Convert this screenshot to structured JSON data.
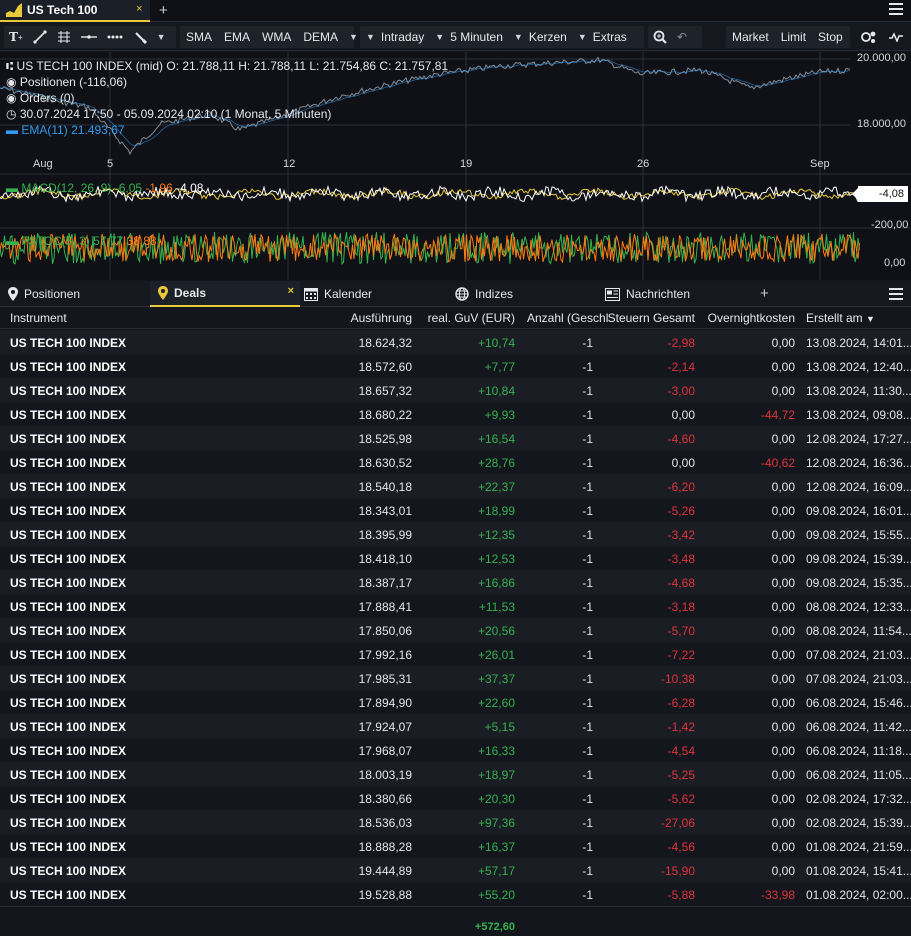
{
  "topbar": {
    "tab_title": "US Tech 100",
    "close_glyph": "×",
    "plus_glyph": "+"
  },
  "toolbar": {
    "indicators": [
      "SMA",
      "EMA",
      "WMA",
      "DEMA"
    ],
    "period": "Intraday",
    "interval": "5 Minuten",
    "chart_type": "Kerzen",
    "extras": "Extras",
    "orders": [
      "Market",
      "Limit",
      "Stop"
    ],
    "icons": [
      "text-tool-icon",
      "line-tool-icon",
      "fib-tool-icon",
      "hline-tool-icon",
      "dotted-line-icon",
      "brush-tool-icon",
      "zoom-icon",
      "undo-icon",
      "compare-icon",
      "signal-icon"
    ]
  },
  "chart": {
    "ohlc_line": "US TECH 100 INDEX (mid)  O: 21.788,11  H: 21.788,11  L: 21.754,86  C: 21.757,81",
    "positions": "Positionen (-116,06)",
    "orders": "Orders (0)",
    "range": "30.07.2024 17:50 - 05.09.2024 02:10  (1 Monat, 5 Minuten)",
    "ema": "EMA(11)  21.493,67",
    "price_axis": [
      "20.000,00",
      "18.000,00"
    ],
    "date_axis": [
      "Aug",
      "5",
      "12",
      "19",
      "26",
      "Sep"
    ],
    "macd_label": "MACD(12, 26, 9)",
    "macd_values": [
      "-6,05",
      "-1,96",
      "-4,08"
    ],
    "macd_tag": "-4,08",
    "macd_axis": "-200,00",
    "fstoc_label": "FSTOC(5, 3)",
    "fstoc_values": [
      "57,77",
      "38,88"
    ],
    "fstoc_axis": "0,00",
    "colors": {
      "price_line": "#7f8c99",
      "ema": "#2e9bf0",
      "macd": "#ffffff",
      "signal": "#e8c93a",
      "fstoc_k": "#35b24e",
      "fstoc_d": "#ff7a12"
    }
  },
  "panel_tabs": [
    {
      "label": "Positionen",
      "icon": "pin-icon"
    },
    {
      "label": "Deals",
      "icon": "marker-icon",
      "active": true
    },
    {
      "label": "Kalender",
      "icon": "calendar-icon"
    },
    {
      "label": "Indizes",
      "icon": "globe-icon"
    },
    {
      "label": "Nachrichten",
      "icon": "news-icon"
    }
  ],
  "table": {
    "headers": [
      "Instrument",
      "Ausführung",
      "real. GuV (EUR)",
      "Anzahl (Geschl",
      "Steuern Gesamt",
      "Overnightkosten",
      "Erstellt am"
    ],
    "sort_indicator": "▼",
    "rows": [
      [
        "US TECH 100 INDEX",
        "18.624,32",
        "+10,74",
        "-1",
        "-2,98",
        "0,00",
        "13.08.2024, 14:01..."
      ],
      [
        "US TECH 100 INDEX",
        "18.572,60",
        "+7,77",
        "-1",
        "-2,14",
        "0,00",
        "13.08.2024, 12:40..."
      ],
      [
        "US TECH 100 INDEX",
        "18.657,32",
        "+10,84",
        "-1",
        "-3,00",
        "0,00",
        "13.08.2024, 11:30..."
      ],
      [
        "US TECH 100 INDEX",
        "18.680,22",
        "+9,93",
        "-1",
        "0,00",
        "-44,72",
        "13.08.2024, 09:08..."
      ],
      [
        "US TECH 100 INDEX",
        "18.525,98",
        "+16,54",
        "-1",
        "-4,60",
        "0,00",
        "12.08.2024, 17:27..."
      ],
      [
        "US TECH 100 INDEX",
        "18.630,52",
        "+28,76",
        "-1",
        "0,00",
        "-40,62",
        "12.08.2024, 16:36..."
      ],
      [
        "US TECH 100 INDEX",
        "18.540,18",
        "+22,37",
        "-1",
        "-6,20",
        "0,00",
        "12.08.2024, 16:09..."
      ],
      [
        "US TECH 100 INDEX",
        "18.343,01",
        "+18,99",
        "-1",
        "-5,26",
        "0,00",
        "09.08.2024, 16:01..."
      ],
      [
        "US TECH 100 INDEX",
        "18.395,99",
        "+12,35",
        "-1",
        "-3,42",
        "0,00",
        "09.08.2024, 15:55..."
      ],
      [
        "US TECH 100 INDEX",
        "18.418,10",
        "+12,53",
        "-1",
        "-3,48",
        "0,00",
        "09.08.2024, 15:39..."
      ],
      [
        "US TECH 100 INDEX",
        "18.387,17",
        "+16,86",
        "-1",
        "-4,68",
        "0,00",
        "09.08.2024, 15:35..."
      ],
      [
        "US TECH 100 INDEX",
        "17.888,41",
        "+11,53",
        "-1",
        "-3,18",
        "0,00",
        "08.08.2024, 12:33..."
      ],
      [
        "US TECH 100 INDEX",
        "17.850,06",
        "+20,56",
        "-1",
        "-5,70",
        "0,00",
        "08.08.2024, 11:54..."
      ],
      [
        "US TECH 100 INDEX",
        "17.992,16",
        "+26,01",
        "-1",
        "-7,22",
        "0,00",
        "07.08.2024, 21:03..."
      ],
      [
        "US TECH 100 INDEX",
        "17.985,31",
        "+37,37",
        "-1",
        "-10,38",
        "0,00",
        "07.08.2024, 21:03..."
      ],
      [
        "US TECH 100 INDEX",
        "17.894,90",
        "+22,60",
        "-1",
        "-6,28",
        "0,00",
        "06.08.2024, 15:46..."
      ],
      [
        "US TECH 100 INDEX",
        "17.924,07",
        "+5,15",
        "-1",
        "-1,42",
        "0,00",
        "06.08.2024, 11:42..."
      ],
      [
        "US TECH 100 INDEX",
        "17.968,07",
        "+16,33",
        "-1",
        "-4,54",
        "0,00",
        "06.08.2024, 11:18..."
      ],
      [
        "US TECH 100 INDEX",
        "18.003,19",
        "+18,97",
        "-1",
        "-5,25",
        "0,00",
        "06.08.2024, 11:05..."
      ],
      [
        "US TECH 100 INDEX",
        "18.380,66",
        "+20,30",
        "-1",
        "-5,62",
        "0,00",
        "02.08.2024, 17:32..."
      ],
      [
        "US TECH 100 INDEX",
        "18.536,03",
        "+97,36",
        "-1",
        "-27,06",
        "0,00",
        "02.08.2024, 15:39..."
      ],
      [
        "US TECH 100 INDEX",
        "18.888,28",
        "+16,37",
        "-1",
        "-4,56",
        "0,00",
        "01.08.2024, 21:59..."
      ],
      [
        "US TECH 100 INDEX",
        "19.444,89",
        "+57,17",
        "-1",
        "-15,90",
        "0,00",
        "01.08.2024, 15:41..."
      ],
      [
        "US TECH 100 INDEX",
        "19.528,88",
        "+55,20",
        "-1",
        "-5,88",
        "-33,98",
        "01.08.2024, 02:00..."
      ]
    ],
    "total_guv": "+572,60"
  }
}
